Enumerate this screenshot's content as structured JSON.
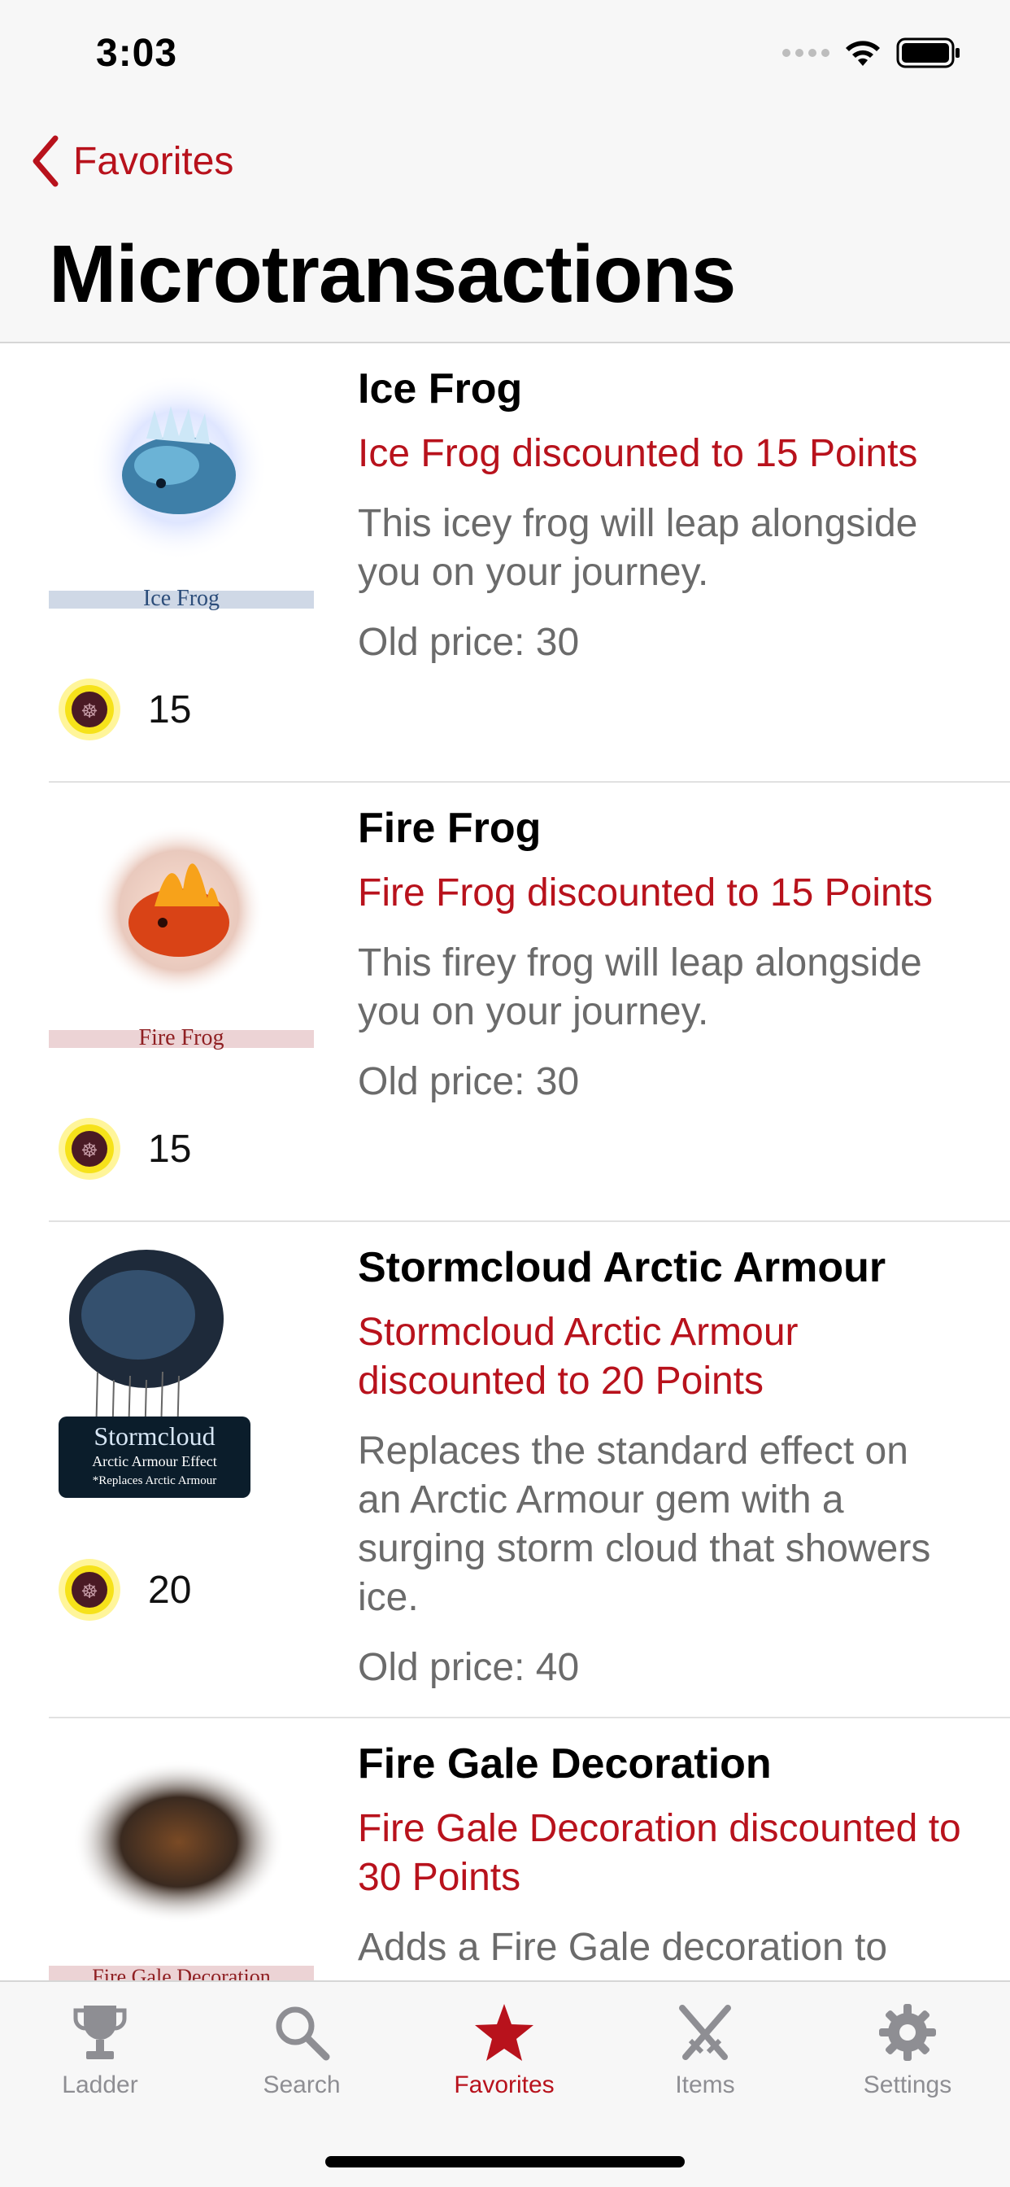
{
  "status": {
    "time": "3:03"
  },
  "nav": {
    "back_label": "Favorites",
    "title": "Microtransactions"
  },
  "items": [
    {
      "name": "Ice Frog",
      "image_label": "Ice Frog",
      "discount_text": "Ice Frog   discounted to 15 Points",
      "description": "This icey frog will leap alongside you on your journey.",
      "old_price": "Old price: 30",
      "price": "15"
    },
    {
      "name": "Fire Frog",
      "image_label": "Fire Frog",
      "discount_text": "Fire Frog   discounted to 15 Points",
      "description": "This firey frog will leap alongside you on your journey.",
      "old_price": "Old price: 30",
      "price": "15"
    },
    {
      "name": "Stormcloud Arctic Armour",
      "image_label": "Stormcloud",
      "image_sublabel": "Arctic Armour Effect",
      "image_note": "*Replaces Arctic Armour",
      "discount_text": "Stormcloud Arctic Armour discounted to 20 Points",
      "description": "Replaces the standard effect on an Arctic Armour gem with a surging storm cloud that showers ice.",
      "old_price": "Old price: 40",
      "price": "20"
    },
    {
      "name": "Fire Gale Decoration",
      "image_label": "Fire Gale Decoration",
      "discount_text": "Fire Gale Decoration discounted to 30 Points",
      "description": "Adds a Fire Gale decoration to your hideout.",
      "old_price": "",
      "price": ""
    }
  ],
  "tabs": [
    {
      "label": "Ladder",
      "icon": "trophy-icon"
    },
    {
      "label": "Search",
      "icon": "search-icon"
    },
    {
      "label": "Favorites",
      "icon": "star-icon",
      "active": true
    },
    {
      "label": "Items",
      "icon": "crossed-swords-icon"
    },
    {
      "label": "Settings",
      "icon": "gear-icon"
    }
  ],
  "colors": {
    "accent": "#b8121c",
    "inactive": "#8e8e93",
    "bar_bg": "#f7f7f7"
  }
}
